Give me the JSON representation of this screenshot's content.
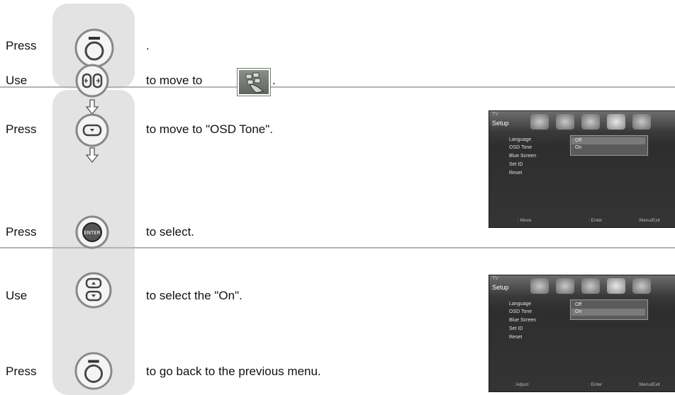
{
  "steps": [
    {
      "label": "Press",
      "text": "."
    },
    {
      "label": "Use",
      "text": "to move to",
      "suffix": "."
    },
    {
      "label": "Press",
      "text": "to move to \"OSD Tone\"."
    },
    {
      "label": "Press",
      "text": "to select."
    },
    {
      "label": "Use",
      "text": "to select the \"On\"."
    },
    {
      "label": "Press",
      "text": "to go back to the previous menu."
    }
  ],
  "buttons": {
    "menu": "MENU",
    "enter": "ENTER"
  },
  "screen1": {
    "header": "TV",
    "title": "Setup",
    "items": [
      "Language",
      "OSD Tone",
      "Blue Screen",
      "Set ID",
      "Reset"
    ],
    "options": [
      "Off",
      "On"
    ],
    "footer": {
      "move": ": Move",
      "enter": ": Enter",
      "exit": ":Menu/Exit"
    }
  },
  "screen2": {
    "header": "TV",
    "title": "Setup",
    "items": [
      "Language",
      "OSD Tone",
      "Blue Screen",
      "Set ID",
      "Reset"
    ],
    "options": [
      "Off",
      "On"
    ],
    "footer": {
      "adjust": ": Adjust",
      "enter": ": Enter",
      "exit": ":Menu/Exit"
    }
  },
  "colors": {
    "panel": "#e3e3e3",
    "divider": "#b4b4b4",
    "osd": "#343434"
  }
}
